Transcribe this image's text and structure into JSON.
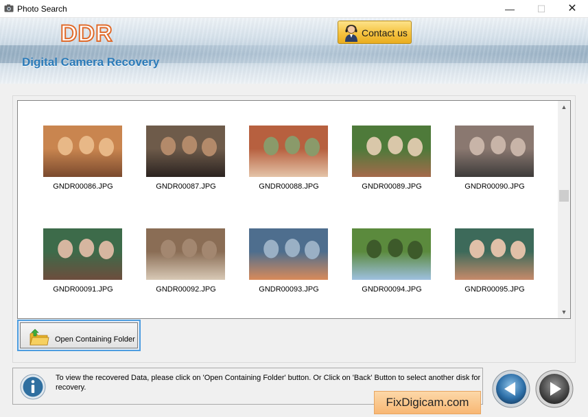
{
  "window": {
    "title": "Photo Search",
    "minimize_glyph": "—",
    "maximize_glyph": "☐",
    "close_glyph": "✕"
  },
  "header": {
    "logo": "DDR",
    "subtitle": "Digital Camera Recovery",
    "contact_label": "Contact us"
  },
  "gallery": {
    "items": [
      {
        "file": "GNDR00086.JPG",
        "colors": [
          "#c9854f",
          "#7a4a2e",
          "#e8b887"
        ]
      },
      {
        "file": "GNDR00087.JPG",
        "colors": [
          "#6e5b4a",
          "#2b2320",
          "#b38a6a"
        ]
      },
      {
        "file": "GNDR00088.JPG",
        "colors": [
          "#b7603f",
          "#e4c4a8",
          "#8a9a6a"
        ]
      },
      {
        "file": "GNDR00089.JPG",
        "colors": [
          "#4e7a3a",
          "#a56a4b",
          "#d9c7a9"
        ]
      },
      {
        "file": "GNDR00090.JPG",
        "colors": [
          "#8a7870",
          "#3d3b3a",
          "#c8b4a8"
        ]
      },
      {
        "file": "GNDR00091.JPG",
        "colors": [
          "#3d6b4a",
          "#6d4d3d",
          "#d6b6a0"
        ]
      },
      {
        "file": "GNDR00092.JPG",
        "colors": [
          "#8a6d55",
          "#d8c9b6",
          "#a38770"
        ]
      },
      {
        "file": "GNDR00093.JPG",
        "colors": [
          "#4e6e8e",
          "#d98a5a",
          "#9ab0c5"
        ]
      },
      {
        "file": "GNDR00094.JPG",
        "colors": [
          "#5b8a3d",
          "#9ec0e0",
          "#3d5a2a"
        ]
      },
      {
        "file": "GNDR00095.JPG",
        "colors": [
          "#3d6a5a",
          "#c78a6a",
          "#e0c0a8"
        ]
      }
    ],
    "scroll_up": "▲",
    "scroll_down": "▼"
  },
  "actions": {
    "open_folder_label": "Open Containing Folder"
  },
  "info": {
    "text": "To view the recovered Data, please click on 'Open Containing Folder' button. Or Click on 'Back' Button to select another disk for recovery."
  },
  "watermark": "FixDigicam.com",
  "colors": {
    "accent_blue": "#2a7ab8",
    "logo_orange": "#e06a2a",
    "contact_gold": "#f6c545"
  }
}
